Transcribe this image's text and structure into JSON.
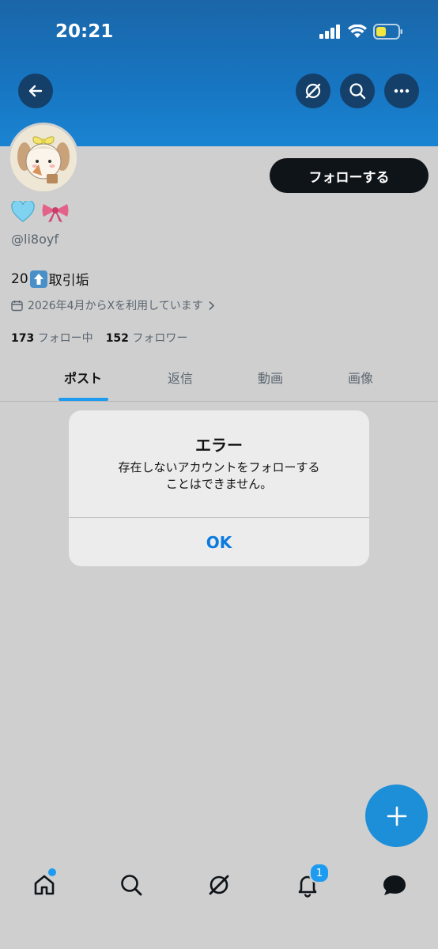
{
  "status_bar": {
    "time": "20:21"
  },
  "header": {
    "back_icon": "arrow-left-icon",
    "grok_icon": "grok-icon",
    "search_icon": "search-icon",
    "more_icon": "more-icon"
  },
  "profile": {
    "follow_label": "フォローする",
    "emojis": [
      "🩵",
      "🎀"
    ],
    "handle": "@li8oyf",
    "bio_prefix": "20",
    "bio_emoji": "⬆️",
    "bio_suffix": "取引垢",
    "joined": "2026年4月からXを利用しています",
    "following_count": "173",
    "following_label": "フォロー中",
    "followers_count": "152",
    "followers_label": "フォロワー"
  },
  "tabs": [
    {
      "label": "ポスト"
    },
    {
      "label": "返信"
    },
    {
      "label": "動画"
    },
    {
      "label": "画像"
    }
  ],
  "dialog": {
    "title": "エラー",
    "message_line1": "存在しないアカウントをフォローする",
    "message_line2": "ことはできません。",
    "ok_label": "OK"
  },
  "bottom_nav": {
    "notifications_badge": "1"
  },
  "colors": {
    "accent": "#1d9bf0",
    "header": "#1776c2",
    "ok_text": "#0a7ae0"
  }
}
